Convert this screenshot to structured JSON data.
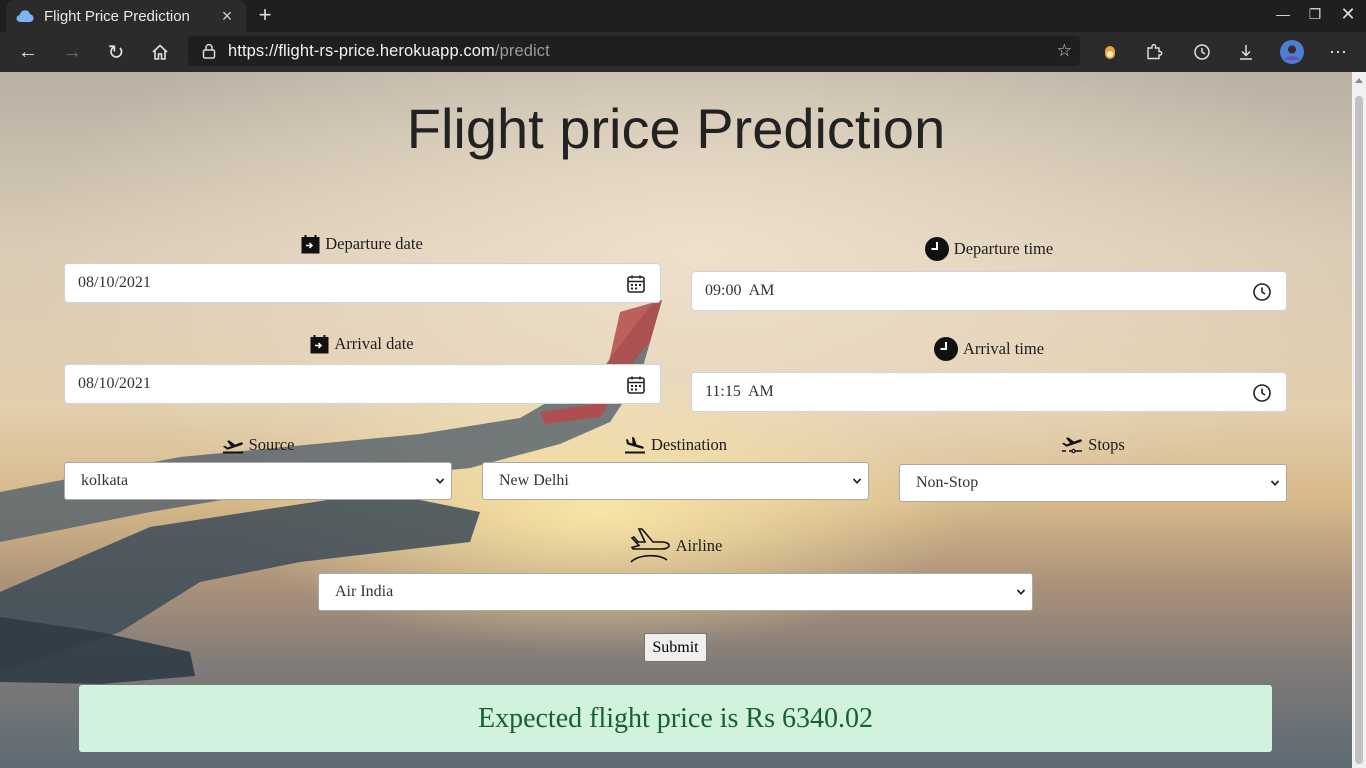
{
  "browser": {
    "tab_title": "Flight Price Prediction",
    "url_host": "https://flight-rs-price.herokuapp.com",
    "url_path": "/predict"
  },
  "page": {
    "title": "Flight price Prediction",
    "departure_date": {
      "label": "Departure date",
      "value": "08/10/2021"
    },
    "arrival_date": {
      "label": "Arrival date",
      "value": "08/10/2021"
    },
    "departure_time": {
      "label": "Departure time",
      "value": "09:00  AM"
    },
    "arrival_time": {
      "label": "Arrival time",
      "value": "11:15  AM"
    },
    "source": {
      "label": "Source",
      "value": "kolkata"
    },
    "destination": {
      "label": "Destination",
      "value": "New Delhi"
    },
    "stops": {
      "label": "Stops",
      "value": "Non-Stop"
    },
    "airline": {
      "label": "Airline",
      "value": "Air India"
    },
    "submit_label": "Submit",
    "result": "Expected flight price is Rs 6340.02"
  },
  "colors": {
    "result_bg": "#d1f3dd",
    "result_text": "#176131"
  }
}
